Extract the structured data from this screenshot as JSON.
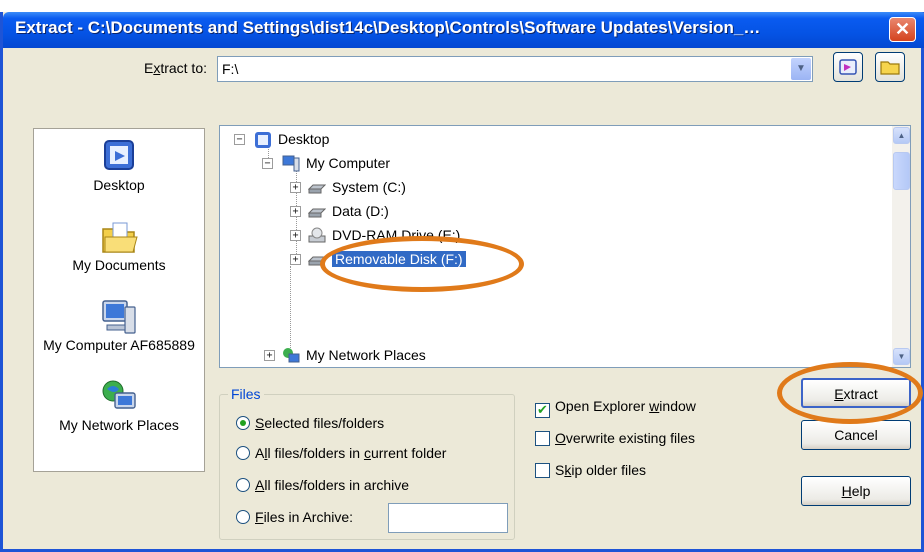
{
  "window": {
    "title": "Extract - C:\\Documents and Settings\\dist14c\\Desktop\\Controls\\Software Updates\\Version_…",
    "close_glyph": "✕"
  },
  "extract_to": {
    "label_pre": "E",
    "label_access": "x",
    "label_post": "tract to:",
    "value": "F:\\"
  },
  "places": [
    {
      "label": "Desktop",
      "icon": "desktop-icon"
    },
    {
      "label": "My Documents",
      "icon": "my-documents-icon"
    },
    {
      "label": "My Computer AF685889",
      "icon": "my-computer-icon"
    },
    {
      "label": "My Network Places",
      "icon": "network-places-icon"
    }
  ],
  "tree": {
    "desktop": "Desktop",
    "my_computer": "My Computer",
    "system": "System (C:)",
    "data": "Data (D:)",
    "dvd": "DVD-RAM Drive (E:)",
    "removable": "Removable Disk (F:)",
    "network": "My Network Places",
    "expand_glyph": "+",
    "collapse_glyph": "−"
  },
  "files": {
    "legend": "Files",
    "opt1_pre": "",
    "opt1_access": "S",
    "opt1_post": "elected files/folders",
    "opt2_pre": "A",
    "opt2_access": "l",
    "opt2_post": "l files/folders in ",
    "opt2_access2": "c",
    "opt2_post2": "urrent folder",
    "opt3_pre": "",
    "opt3_access": "A",
    "opt3_post": "ll files/folders in archive",
    "opt4_pre": "",
    "opt4_access": "F",
    "opt4_post": "iles in Archive:",
    "archive_value": ""
  },
  "options": {
    "open_explorer_pre": "Open Explorer ",
    "open_explorer_access": "w",
    "open_explorer_post": "indow",
    "overwrite_pre": "",
    "overwrite_access": "O",
    "overwrite_post": "verwrite existing files",
    "skip_pre": "S",
    "skip_access": "k",
    "skip_post": "ip older files",
    "check_glyph": "✔"
  },
  "buttons": {
    "extract_pre": "",
    "extract_access": "E",
    "extract_post": "xtract",
    "cancel": "Cancel",
    "help_pre": "",
    "help_access": "H",
    "help_post": "elp"
  },
  "colors": {
    "title_bar": "#0553e4",
    "selection": "#316ac5",
    "annotation": "#e07a1a"
  }
}
